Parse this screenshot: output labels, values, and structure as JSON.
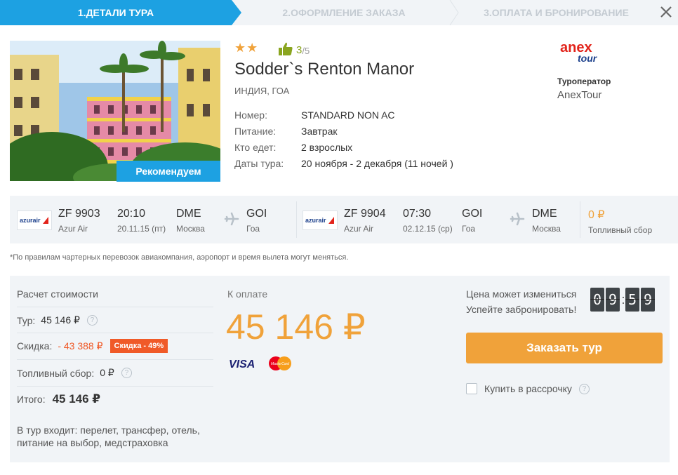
{
  "steps": [
    {
      "label": "1.Детали тура",
      "active": true
    },
    {
      "label": "2.Оформление заказа",
      "active": false
    },
    {
      "label": "3.Оплата и бронирование",
      "active": false
    }
  ],
  "hotel": {
    "stars": "★★",
    "rating_value": "3",
    "rating_of": "/5",
    "name": "Sodder`s Renton Manor",
    "location": "ИНДИЯ, ГОА",
    "badge": "Рекомендуем",
    "details": [
      {
        "label": "Номер:",
        "value": "STANDARD NON AC"
      },
      {
        "label": "Питание:",
        "value": "Завтрак"
      },
      {
        "label": "Кто едет:",
        "value": "2 взрослых"
      },
      {
        "label": "Даты тура:",
        "value": "20 ноября - 2 декабря (11 ночей )"
      }
    ]
  },
  "operator": {
    "logo_top": "anex",
    "logo_bottom": "tour",
    "label": "Туроператор",
    "name": "AnexTour"
  },
  "flights": [
    {
      "airline_logo": "azurair",
      "flight_no": "ZF 9903",
      "airline": "Azur Air",
      "time": "20:10",
      "date": "20.11.15 (пт)",
      "from_code": "DME",
      "from_city": "Москва",
      "to_code": "GOI",
      "to_city": "Гоа"
    },
    {
      "airline_logo": "azurair",
      "flight_no": "ZF 9904",
      "airline": "Azur Air",
      "time": "07:30",
      "date": "02.12.15 (ср)",
      "from_code": "GOI",
      "from_city": "Гоа",
      "to_code": "DME",
      "to_city": "Москва"
    }
  ],
  "fuel": {
    "price": "0 ₽",
    "label": "Топливный сбор"
  },
  "note": "*По правилам чартерных перевозок авиакомпания, аэропорт и время вылета могут меняться.",
  "calc": {
    "title": "Расчет стоимости",
    "tour_label": "Тур:",
    "tour_value": "45 146 ₽",
    "discount_label": "Скидка:",
    "discount_value": "- 43 388 ₽",
    "discount_badge": "Скидка - 49%",
    "fuel_label": "Топливный сбор:",
    "fuel_value": "0 ₽",
    "total_label": "Итого:",
    "total_value": "45 146 ₽",
    "includes": "В тур входит: перелет, трансфер, отель, питание на выбор, медстраховка"
  },
  "payment": {
    "label": "К оплате",
    "amount": "45 146 ₽",
    "visa": "VISA",
    "mastercard": "MasterCard"
  },
  "booking": {
    "price_may_change": "Цена может измениться",
    "hurry": "Успейте забронировать!",
    "timer_digits": [
      "0",
      "9",
      "5",
      "9"
    ],
    "order_button": "Заказать тур",
    "installment": "Купить в рассрочку"
  },
  "colors": {
    "accent_blue": "#1da1e2",
    "accent_orange": "#f0a23a",
    "discount_red": "#f05a28"
  },
  "icons": {
    "close": "close-icon",
    "thumb": "thumbs-up-icon",
    "plane": "plane-icon",
    "help": "question-icon"
  }
}
